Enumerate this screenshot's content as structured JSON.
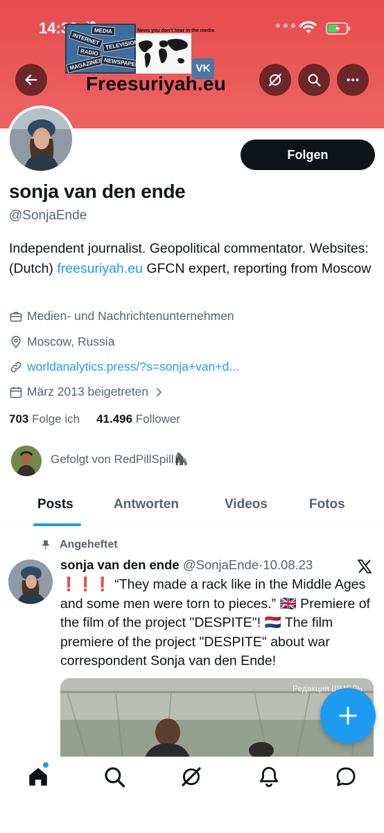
{
  "status_bar": {
    "time": "14:38"
  },
  "banner": {
    "site_text": "Freesuriyah.eu",
    "caption": "News you don't hear in  the media",
    "signs": [
      "MEDIA",
      "INTERNET",
      "TELEVISION",
      "RADIO",
      "MAGAZINES",
      "NEWSPAPERS"
    ],
    "vk_label": "VK"
  },
  "profile": {
    "follow_label": "Folgen",
    "name": "sonja van den ende",
    "handle": "@SonjaEnde",
    "bio_before": "Independent journalist. Geopolitical commentator. Websites:(Dutch) ",
    "bio_link": "freesuriyah.eu",
    "bio_after": " GFCN expert, reporting from Moscow",
    "category": "Medien- und Nachrichtenunternehmen",
    "location": "Moscow, Russia",
    "website": "worldanalytics.press/?s=sonja+van+d...",
    "joined": "März 2013 beigetreten",
    "following_count": "703",
    "following_label": "Folge ich",
    "followers_count": "41.496",
    "followers_label": "Follower",
    "followed_by": "Gefolgt von RedPillSpill🦍"
  },
  "tabs": [
    {
      "label": "Posts",
      "active": true
    },
    {
      "label": "Antworten",
      "active": false
    },
    {
      "label": "Videos",
      "active": false
    },
    {
      "label": "Fotos",
      "active": false
    }
  ],
  "post": {
    "pinned_label": "Angeheftet",
    "author_name": "sonja van den ende",
    "author_handle": "@SonjaEnde",
    "separator": "·",
    "date": "10.08.23",
    "text": "❗❗❗ “They made a rack like in the Middle Ages and some men were torn to pieces.” 🇬🇧 Premiere of the film of the project \"DESPITE\"! 🇳🇱 The film premiere of the project \"DESPITE\" about war correspondent Sonja van den Ende!",
    "media_watermark": "Редакция ШМЕЛЬ"
  },
  "icons": {
    "back": "arrow-left-icon",
    "grok": "grok-icon",
    "search": "search-icon",
    "more": "more-icon",
    "compose": "plus-icon",
    "nav": [
      "home-icon",
      "search-icon",
      "grok-icon",
      "bell-icon",
      "messages-icon"
    ]
  },
  "colors": {
    "accent": "#1d9bf0",
    "banner": "#e64b4e",
    "text": "#0f1419",
    "secondary": "#536471"
  }
}
